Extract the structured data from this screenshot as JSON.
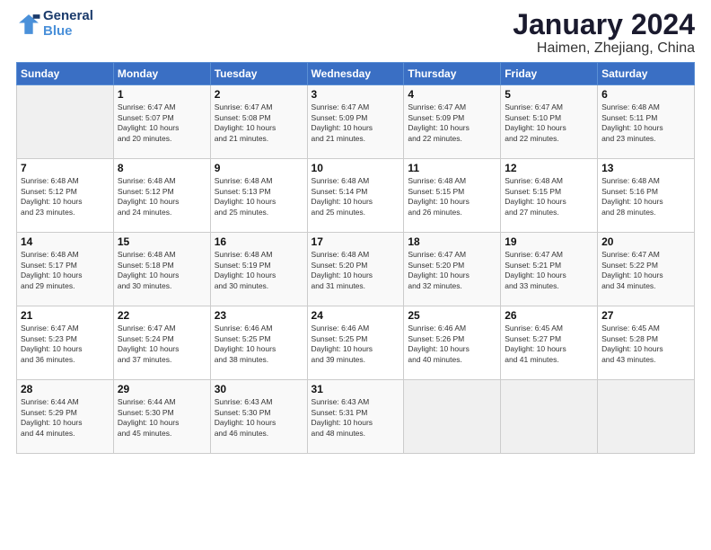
{
  "header": {
    "logo_line1": "General",
    "logo_line2": "Blue",
    "title": "January 2024",
    "subtitle": "Haimen, Zhejiang, China"
  },
  "columns": [
    "Sunday",
    "Monday",
    "Tuesday",
    "Wednesday",
    "Thursday",
    "Friday",
    "Saturday"
  ],
  "weeks": [
    [
      {
        "day": "",
        "info": ""
      },
      {
        "day": "1",
        "info": "Sunrise: 6:47 AM\nSunset: 5:07 PM\nDaylight: 10 hours\nand 20 minutes."
      },
      {
        "day": "2",
        "info": "Sunrise: 6:47 AM\nSunset: 5:08 PM\nDaylight: 10 hours\nand 21 minutes."
      },
      {
        "day": "3",
        "info": "Sunrise: 6:47 AM\nSunset: 5:09 PM\nDaylight: 10 hours\nand 21 minutes."
      },
      {
        "day": "4",
        "info": "Sunrise: 6:47 AM\nSunset: 5:09 PM\nDaylight: 10 hours\nand 22 minutes."
      },
      {
        "day": "5",
        "info": "Sunrise: 6:47 AM\nSunset: 5:10 PM\nDaylight: 10 hours\nand 22 minutes."
      },
      {
        "day": "6",
        "info": "Sunrise: 6:48 AM\nSunset: 5:11 PM\nDaylight: 10 hours\nand 23 minutes."
      }
    ],
    [
      {
        "day": "7",
        "info": "Sunrise: 6:48 AM\nSunset: 5:12 PM\nDaylight: 10 hours\nand 23 minutes."
      },
      {
        "day": "8",
        "info": "Sunrise: 6:48 AM\nSunset: 5:12 PM\nDaylight: 10 hours\nand 24 minutes."
      },
      {
        "day": "9",
        "info": "Sunrise: 6:48 AM\nSunset: 5:13 PM\nDaylight: 10 hours\nand 25 minutes."
      },
      {
        "day": "10",
        "info": "Sunrise: 6:48 AM\nSunset: 5:14 PM\nDaylight: 10 hours\nand 25 minutes."
      },
      {
        "day": "11",
        "info": "Sunrise: 6:48 AM\nSunset: 5:15 PM\nDaylight: 10 hours\nand 26 minutes."
      },
      {
        "day": "12",
        "info": "Sunrise: 6:48 AM\nSunset: 5:15 PM\nDaylight: 10 hours\nand 27 minutes."
      },
      {
        "day": "13",
        "info": "Sunrise: 6:48 AM\nSunset: 5:16 PM\nDaylight: 10 hours\nand 28 minutes."
      }
    ],
    [
      {
        "day": "14",
        "info": "Sunrise: 6:48 AM\nSunset: 5:17 PM\nDaylight: 10 hours\nand 29 minutes."
      },
      {
        "day": "15",
        "info": "Sunrise: 6:48 AM\nSunset: 5:18 PM\nDaylight: 10 hours\nand 30 minutes."
      },
      {
        "day": "16",
        "info": "Sunrise: 6:48 AM\nSunset: 5:19 PM\nDaylight: 10 hours\nand 30 minutes."
      },
      {
        "day": "17",
        "info": "Sunrise: 6:48 AM\nSunset: 5:20 PM\nDaylight: 10 hours\nand 31 minutes."
      },
      {
        "day": "18",
        "info": "Sunrise: 6:47 AM\nSunset: 5:20 PM\nDaylight: 10 hours\nand 32 minutes."
      },
      {
        "day": "19",
        "info": "Sunrise: 6:47 AM\nSunset: 5:21 PM\nDaylight: 10 hours\nand 33 minutes."
      },
      {
        "day": "20",
        "info": "Sunrise: 6:47 AM\nSunset: 5:22 PM\nDaylight: 10 hours\nand 34 minutes."
      }
    ],
    [
      {
        "day": "21",
        "info": "Sunrise: 6:47 AM\nSunset: 5:23 PM\nDaylight: 10 hours\nand 36 minutes."
      },
      {
        "day": "22",
        "info": "Sunrise: 6:47 AM\nSunset: 5:24 PM\nDaylight: 10 hours\nand 37 minutes."
      },
      {
        "day": "23",
        "info": "Sunrise: 6:46 AM\nSunset: 5:25 PM\nDaylight: 10 hours\nand 38 minutes."
      },
      {
        "day": "24",
        "info": "Sunrise: 6:46 AM\nSunset: 5:25 PM\nDaylight: 10 hours\nand 39 minutes."
      },
      {
        "day": "25",
        "info": "Sunrise: 6:46 AM\nSunset: 5:26 PM\nDaylight: 10 hours\nand 40 minutes."
      },
      {
        "day": "26",
        "info": "Sunrise: 6:45 AM\nSunset: 5:27 PM\nDaylight: 10 hours\nand 41 minutes."
      },
      {
        "day": "27",
        "info": "Sunrise: 6:45 AM\nSunset: 5:28 PM\nDaylight: 10 hours\nand 43 minutes."
      }
    ],
    [
      {
        "day": "28",
        "info": "Sunrise: 6:44 AM\nSunset: 5:29 PM\nDaylight: 10 hours\nand 44 minutes."
      },
      {
        "day": "29",
        "info": "Sunrise: 6:44 AM\nSunset: 5:30 PM\nDaylight: 10 hours\nand 45 minutes."
      },
      {
        "day": "30",
        "info": "Sunrise: 6:43 AM\nSunset: 5:30 PM\nDaylight: 10 hours\nand 46 minutes."
      },
      {
        "day": "31",
        "info": "Sunrise: 6:43 AM\nSunset: 5:31 PM\nDaylight: 10 hours\nand 48 minutes."
      },
      {
        "day": "",
        "info": ""
      },
      {
        "day": "",
        "info": ""
      },
      {
        "day": "",
        "info": ""
      }
    ]
  ]
}
